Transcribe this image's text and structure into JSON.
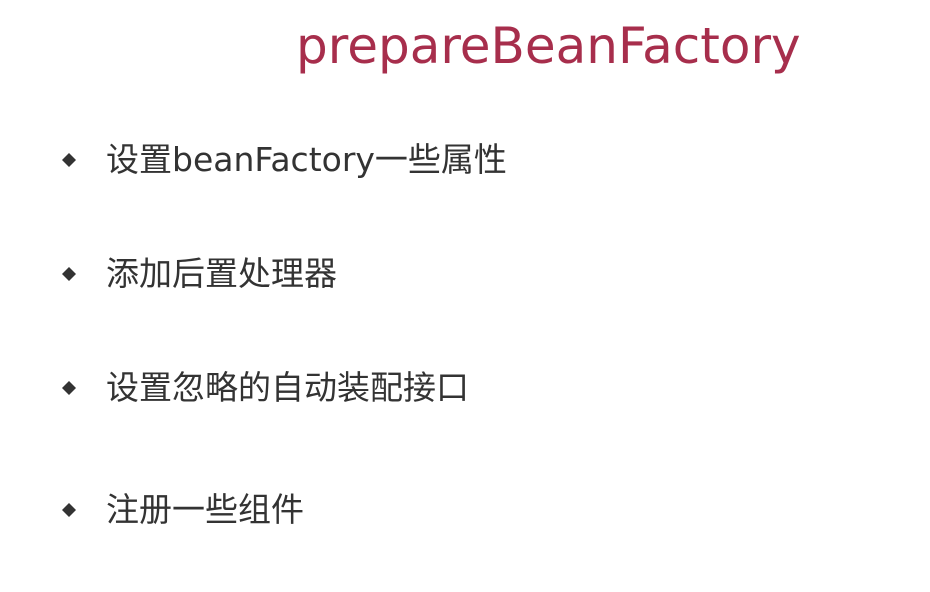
{
  "slide": {
    "title": "prepareBeanFactory",
    "title_color": "#a72e4c",
    "text_color": "#333333",
    "bullet_icon": "diamond-bullet-icon",
    "bullets": [
      {
        "text": "设置beanFactory一些属性"
      },
      {
        "text": "添加后置处理器"
      },
      {
        "text": "设置忽略的自动装配接口"
      },
      {
        "text": "注册一些组件"
      }
    ]
  }
}
